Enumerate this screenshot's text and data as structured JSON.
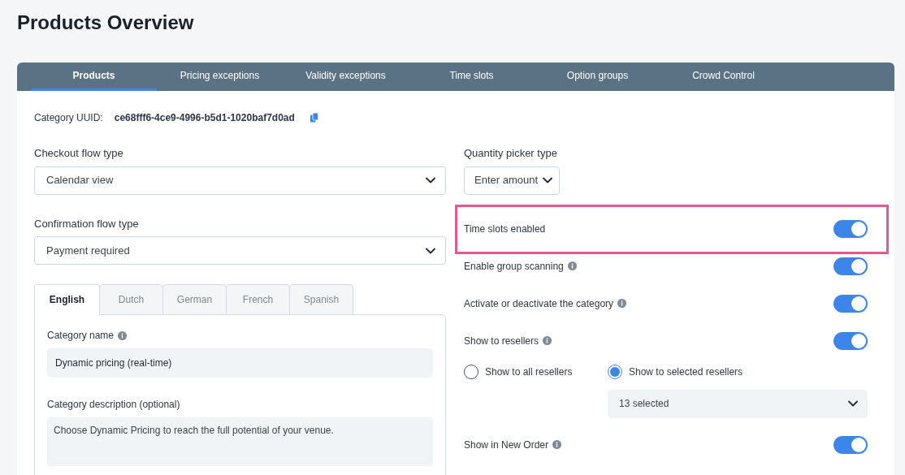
{
  "title": "Products Overview",
  "tabs": [
    {
      "label": "Products",
      "selected": true
    },
    {
      "label": "Pricing exceptions",
      "selected": false
    },
    {
      "label": "Validity exceptions",
      "selected": false
    },
    {
      "label": "Time slots",
      "selected": false
    },
    {
      "label": "Option groups",
      "selected": false
    },
    {
      "label": "Crowd Control",
      "selected": false
    }
  ],
  "uuid": {
    "label": "Category UUID:",
    "value": "ce68fff6-4ce9-4996-b5d1-1020baf7d0ad"
  },
  "checkout_flow": {
    "label": "Checkout flow type",
    "value": "Calendar view"
  },
  "confirmation_flow": {
    "label": "Confirmation flow type",
    "value": "Payment required"
  },
  "language_tabs": [
    {
      "label": "English",
      "selected": true
    },
    {
      "label": "Dutch",
      "selected": false
    },
    {
      "label": "German",
      "selected": false
    },
    {
      "label": "French",
      "selected": false
    },
    {
      "label": "Spanish",
      "selected": false
    }
  ],
  "category_name": {
    "label": "Category name",
    "info": true,
    "value": "Dynamic pricing (real-time)"
  },
  "category_description": {
    "label": "Category description (optional)",
    "value": "Choose Dynamic Pricing to reach the full potential of your venue."
  },
  "quantity_picker": {
    "label": "Quantity picker type",
    "value": "Enter amount"
  },
  "settings": [
    {
      "label": "Time slots enabled",
      "info": false,
      "on": true,
      "highlighted": true
    },
    {
      "label": "Enable group scanning",
      "info": true,
      "on": true,
      "highlighted": false
    },
    {
      "label": "Activate or deactivate the category",
      "info": true,
      "on": true,
      "highlighted": false
    },
    {
      "label": "Show to resellers",
      "info": true,
      "on": true,
      "highlighted": false,
      "radios": [
        {
          "label": "Show to all resellers",
          "selected": false
        },
        {
          "label": "Show to selected resellers",
          "selected": true
        }
      ],
      "select": {
        "value": "13 selected"
      }
    },
    {
      "label": "Show in New Order",
      "info": true,
      "on": true,
      "highlighted": false
    }
  ]
}
